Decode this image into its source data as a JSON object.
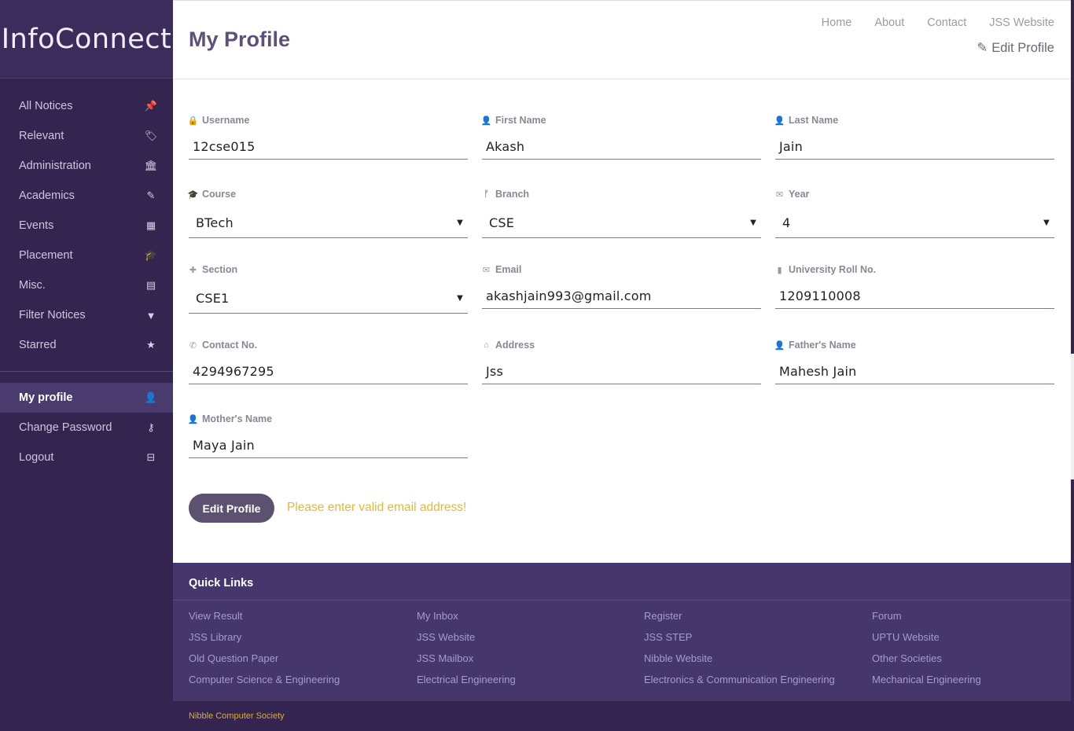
{
  "brand": "InfoConnect",
  "sidebar": {
    "items": [
      {
        "label": "All Notices",
        "icon": "pushpin-icon",
        "glyph": "📌"
      },
      {
        "label": "Relevant",
        "icon": "tags-icon",
        "glyph": "🏷"
      },
      {
        "label": "Administration",
        "icon": "bank-icon",
        "glyph": "🏛"
      },
      {
        "label": "Academics",
        "icon": "edit-icon",
        "glyph": "✎"
      },
      {
        "label": "Events",
        "icon": "calendar-icon",
        "glyph": "▦"
      },
      {
        "label": "Placement",
        "icon": "graduation-cap-icon",
        "glyph": "🎓"
      },
      {
        "label": "Misc.",
        "icon": "list-alt-icon",
        "glyph": "▤"
      },
      {
        "label": "Filter Notices",
        "icon": "filter-icon",
        "glyph": "▼"
      },
      {
        "label": "Starred",
        "icon": "star-icon",
        "glyph": "★"
      }
    ],
    "account_items": [
      {
        "label": "My profile",
        "icon": "user-icon",
        "glyph": "👤",
        "active": true
      },
      {
        "label": "Change Password",
        "icon": "key-icon",
        "glyph": "⚷"
      },
      {
        "label": "Logout",
        "icon": "inbox-icon",
        "glyph": "⊟"
      }
    ]
  },
  "header": {
    "title": "My Profile",
    "nav": [
      "Home",
      "About",
      "Contact",
      "JSS Website"
    ],
    "edit_link": "Edit Profile"
  },
  "form": {
    "username": {
      "label": "Username",
      "value": "12cse015",
      "icon": "lock-icon"
    },
    "first_name": {
      "label": "First Name",
      "value": "Akash",
      "icon": "user-icon"
    },
    "last_name": {
      "label": "Last Name",
      "value": "Jain",
      "icon": "user-icon"
    },
    "course": {
      "label": "Course",
      "value": "BTech",
      "icon": "graduation-cap-icon"
    },
    "branch": {
      "label": "Branch",
      "value": "CSE",
      "icon": "code-fork-icon"
    },
    "year": {
      "label": "Year",
      "value": "4",
      "icon": "envelope-icon"
    },
    "section": {
      "label": "Section",
      "value": "CSE1",
      "icon": "puzzle-icon"
    },
    "email": {
      "label": "Email",
      "value": "akashjain993@gmail.com",
      "icon": "envelope-icon"
    },
    "roll_no": {
      "label": "University Roll No.",
      "value": "1209110008",
      "icon": "book-icon"
    },
    "contact": {
      "label": "Contact No.",
      "value": "4294967295",
      "icon": "phone-icon"
    },
    "address": {
      "label": "Address",
      "value": "Jss",
      "icon": "home-icon"
    },
    "father": {
      "label": "Father's Name",
      "value": "Mahesh Jain",
      "icon": "user-icon"
    },
    "mother": {
      "label": "Mother's Name",
      "value": "Maya Jain",
      "icon": "user-icon"
    },
    "submit_label": "Edit Profile",
    "error": "Please enter valid email address!"
  },
  "footer": {
    "title": "Quick Links",
    "links": [
      [
        "View Result",
        "My Inbox",
        "Register",
        "Forum"
      ],
      [
        "JSS Library",
        "JSS Website",
        "JSS STEP",
        "UPTU Website"
      ],
      [
        "Old Question Paper",
        "JSS Mailbox",
        "Nibble Website",
        "Other Societies"
      ],
      [
        "Computer Science & Engineering",
        "Electrical Engineering",
        "Electronics & Communication Engineering",
        "Mechanical Engineering"
      ]
    ],
    "copyright": "Nibble Computer Society"
  },
  "colors": {
    "sidebar_bg": "#33254f",
    "accent": "#5e5078",
    "footer_bg": "#45366b",
    "error": "#e6b83a"
  }
}
